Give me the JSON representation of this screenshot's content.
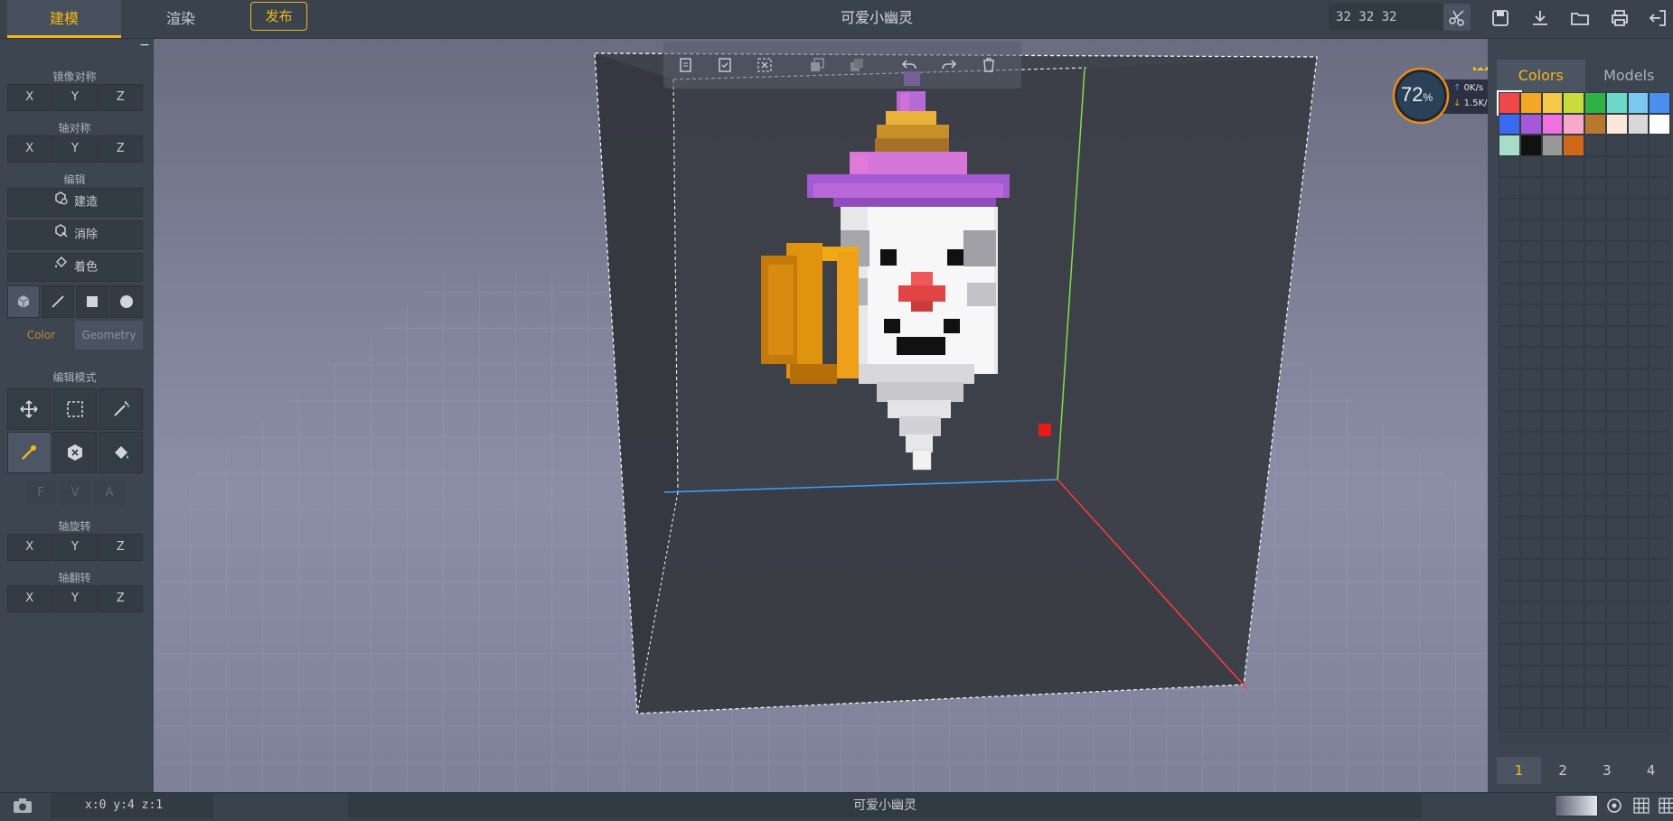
{
  "topbar": {
    "tab_model": "建模",
    "tab_render": "渲染",
    "publish_label": "发布",
    "title": "可爱小幽灵",
    "dims": "32  32  32"
  },
  "left": {
    "mirror_title": "镜像对称",
    "axis_sym_title": "轴对称",
    "edit_title": "编辑",
    "build_label": "建造",
    "erase_label": "消除",
    "paint_label": "着色",
    "color_tab": "Color",
    "geometry_tab": "Geometry",
    "edit_mode_title": "编辑模式",
    "rotate_title": "轴旋转",
    "flip_title": "轴翻转",
    "axes": [
      "X",
      "Y",
      "Z"
    ],
    "fva": [
      "F",
      "V",
      "A"
    ],
    "collapse": "−"
  },
  "right": {
    "tab_colors": "Colors",
    "tab_models": "Models",
    "palette": [
      "#f04848",
      "#f5a623",
      "#f6c84a",
      "#c8dc3c",
      "#2fb344",
      "#6ed8c8",
      "#7ac8f0",
      "#4a8ef0",
      "#3a6af0",
      "#a45ad8",
      "#f070e0",
      "#f8a8c8",
      "#b87830",
      "#fbe8d8",
      "#d8d8d8",
      "#ffffff",
      "#a8dcc8",
      "#111111",
      "#989898",
      "#d06818"
    ],
    "pages": [
      "1",
      "2",
      "3",
      "4"
    ]
  },
  "speed": {
    "percent": "72",
    "percent_sign": "%",
    "up": "0K/s",
    "down": "1.5K/s"
  },
  "status": {
    "coords": "x:0  y:4  z:1",
    "model_name": "可爱小幽灵"
  },
  "colors": {
    "accent": "#f5b617",
    "panel": "#3d4551",
    "bar": "#39424d"
  }
}
